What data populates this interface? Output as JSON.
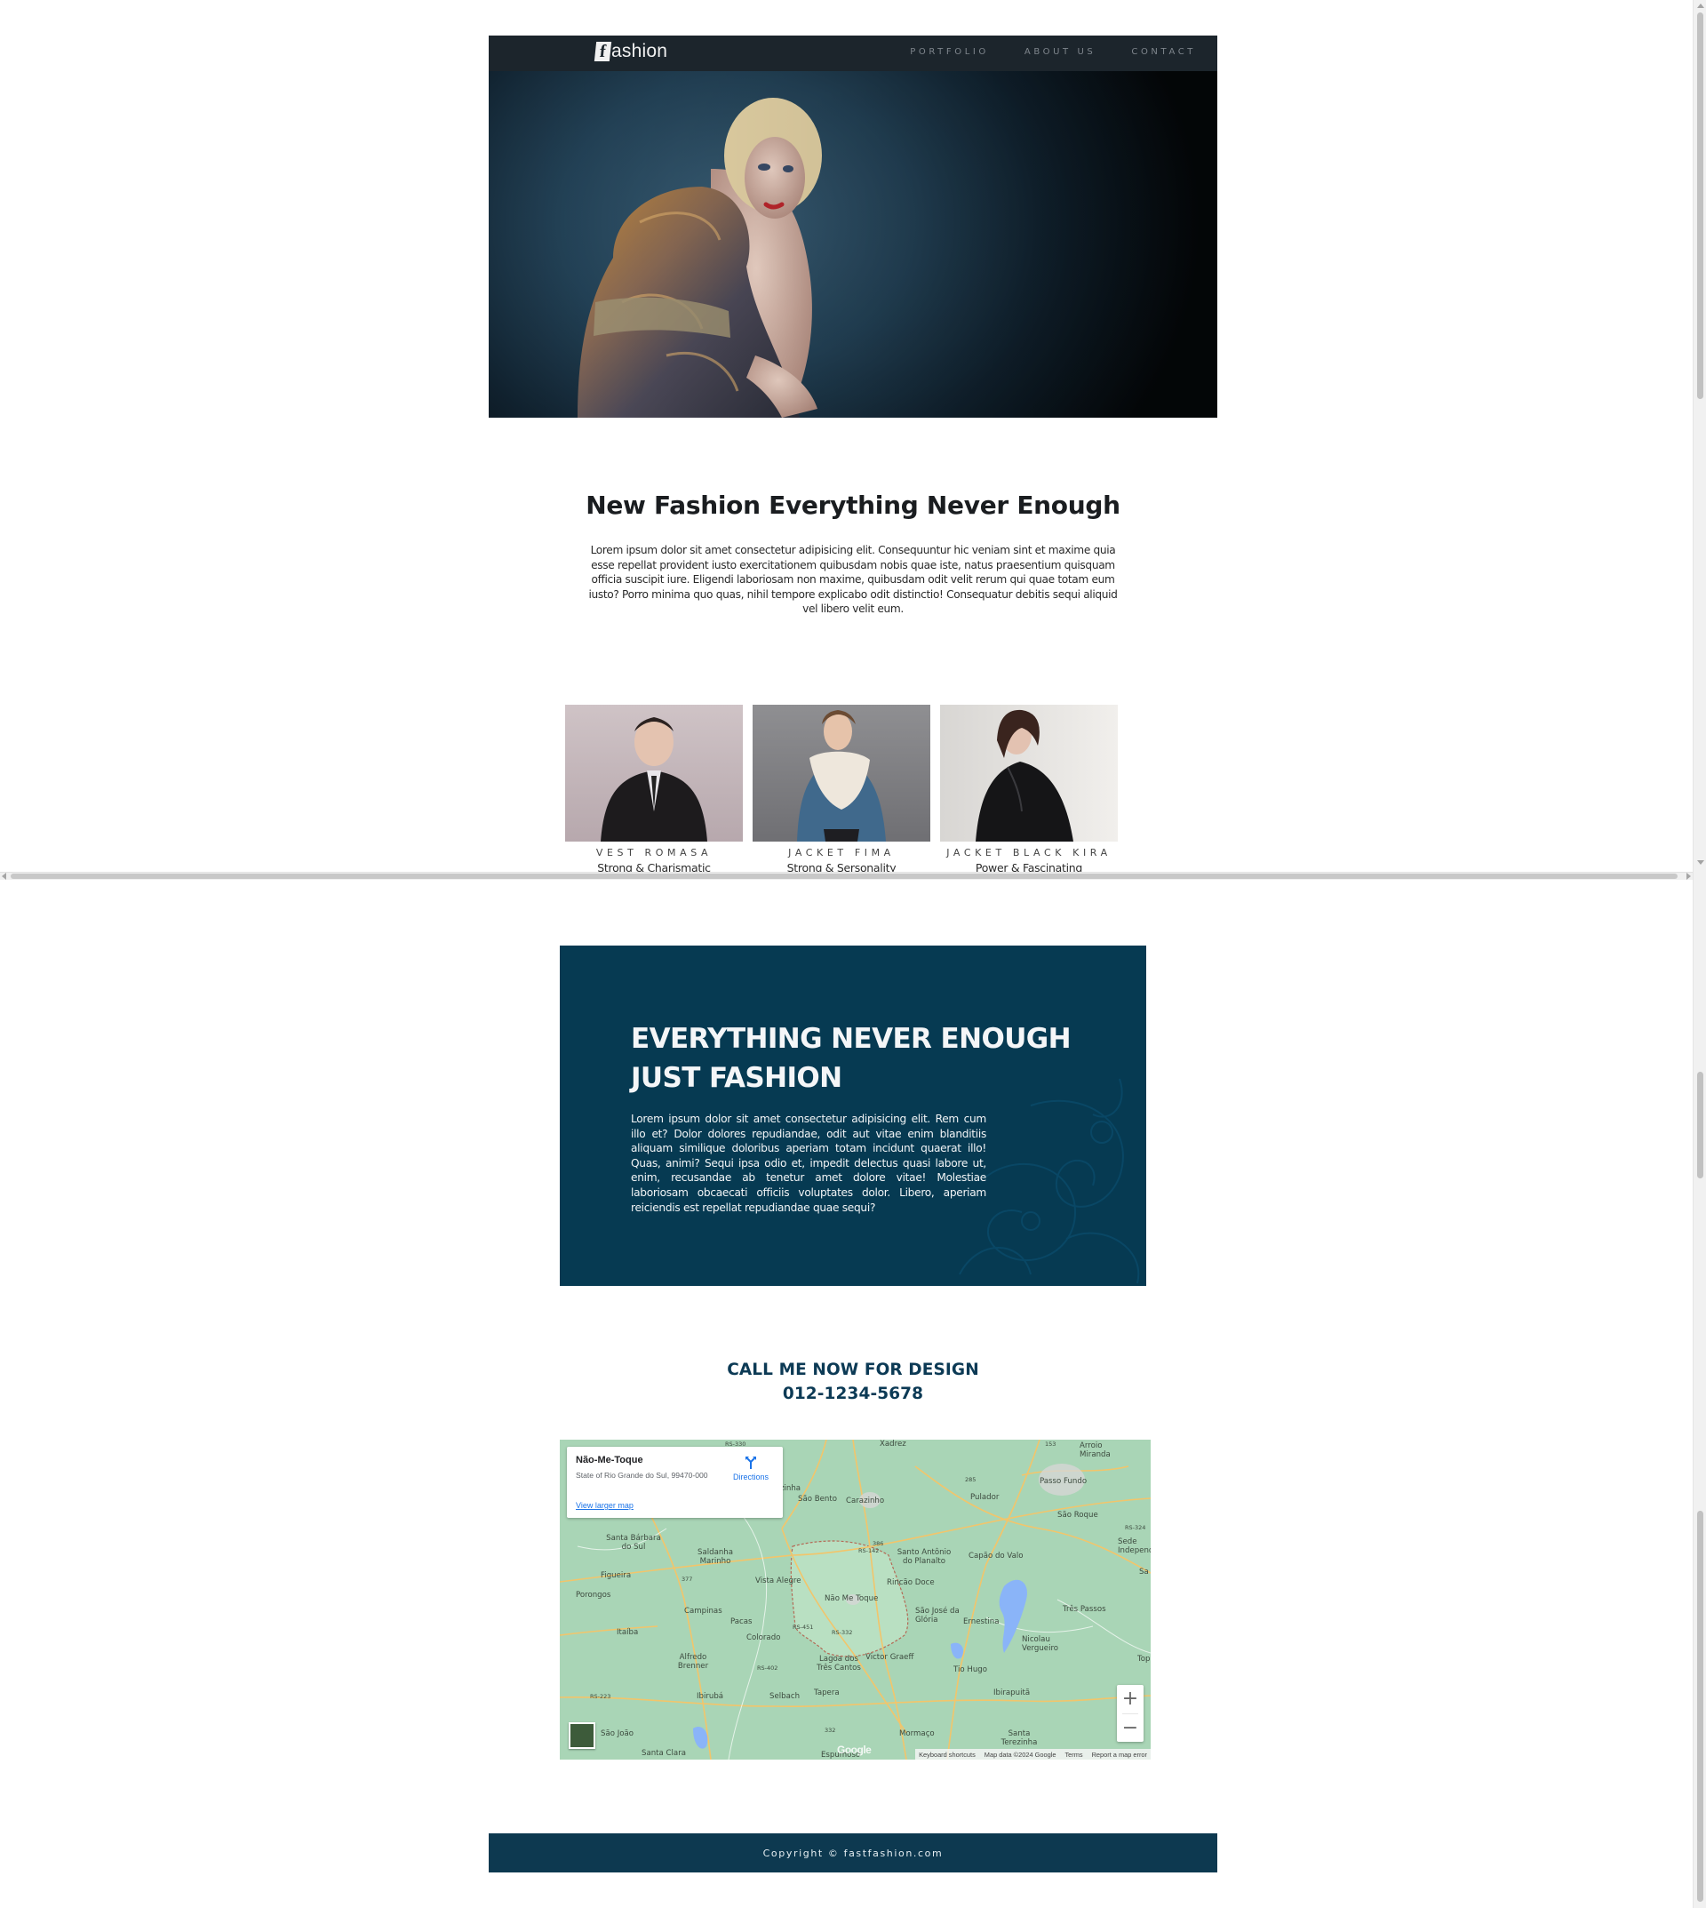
{
  "header": {
    "logo_mark": "f",
    "logo_text": "ashion",
    "nav": [
      {
        "label": "PORTFOLIO"
      },
      {
        "label": "ABOUT US"
      },
      {
        "label": "CONTACT"
      }
    ]
  },
  "intro": {
    "title": "New Fashion Everything Never Enough",
    "text": "Lorem ipsum dolor sit amet consectetur adipisicing elit. Consequuntur hic veniam sint et maxime quia esse repellat provident iusto exercitationem quibusdam nobis quae iste, natus praesentium quisquam officia suscipit iure. Eligendi laboriosam non maxime, quibusdam odit velit rerum qui quae totam eum iusto? Porro minima quo quas, nihil tempore explicabo odit distinctio! Consequatur debitis sequi aliquid vel libero velit eum."
  },
  "products": [
    {
      "name": "VEST ROMASA",
      "tag": "Strong & Charismatic"
    },
    {
      "name": "JACKET FIMA",
      "tag": "Strong & Sersonality"
    },
    {
      "name": "JACKET BLACK KIRA",
      "tag": "Power & Fascinating"
    }
  ],
  "promo": {
    "title_line1": "EVERYTHING NEVER ENOUGH",
    "title_line2": "JUST FASHION",
    "text": "Lorem ipsum dolor sit amet consectetur adipisicing elit. Rem cum illo et? Dolor dolores repudiandae, odit aut vitae enim blanditiis aliquam similique doloribus aperiam totam incidunt quaerat illo! Quas, animi? Sequi ipsa odio et, impedit delectus quasi labore ut, enim, recusandae ab tenetur amet dolore vitae! Molestiae laboriosam obcaecati officiis voluptates dolor. Libero, aperiam reiciendis est repellat repudiandae quae sequi?",
    "bg_color": "#063a52"
  },
  "call": {
    "line1": "CALL ME NOW FOR DESIGN",
    "line2": "012-1234-5678"
  },
  "map": {
    "place_name": "Não-Me-Toque",
    "address": "State of Rio Grande do Sul, 99470-000",
    "directions_label": "Directions",
    "larger_map_label": "View larger map",
    "zoom_in": "+",
    "zoom_out": "−",
    "google_label": "Google",
    "attribution": {
      "shortcuts": "Keyboard shortcuts",
      "data": "Map data ©2024 Google",
      "terms": "Terms",
      "report": "Report a map error"
    },
    "places": [
      {
        "name": "Xadrez"
      },
      {
        "name": "Arroio Miranda"
      },
      {
        "name": "Passo Fundo"
      },
      {
        "name": "São Bento"
      },
      {
        "name": "Carazinho"
      },
      {
        "name": "Pulador"
      },
      {
        "name": "São Roque"
      },
      {
        "name": "Santa Bárbara do Sul"
      },
      {
        "name": "Saldanha Marinho"
      },
      {
        "name": "Santo Antônio do Planalto"
      },
      {
        "name": "Capão do Valo"
      },
      {
        "name": "Sede Independente"
      },
      {
        "name": "Figueira"
      },
      {
        "name": "Vista Alegre"
      },
      {
        "name": "Rincão Doce"
      },
      {
        "name": "Porongos"
      },
      {
        "name": "Não Me Toque"
      },
      {
        "name": "Campinas"
      },
      {
        "name": "Pacas"
      },
      {
        "name": "São José da Glória"
      },
      {
        "name": "Ernestina"
      },
      {
        "name": "Três Passos"
      },
      {
        "name": "Itaíba"
      },
      {
        "name": "Colorado"
      },
      {
        "name": "Nicolau Vergueiro"
      },
      {
        "name": "Alfredo Brenner"
      },
      {
        "name": "Lagoa dos Três Cantos"
      },
      {
        "name": "Victor Graeff"
      },
      {
        "name": "Tio Hugo"
      },
      {
        "name": "Ibirubá"
      },
      {
        "name": "Selbach"
      },
      {
        "name": "Tapera"
      },
      {
        "name": "Ibirapuitã"
      },
      {
        "name": "São João"
      },
      {
        "name": "Mormaço"
      },
      {
        "name": "Santa Terezinha"
      },
      {
        "name": "Santa Clara"
      },
      {
        "name": "Espumoso"
      },
      {
        "name": "Top"
      },
      {
        "name": "Sa"
      },
      {
        "name": "zinha"
      }
    ],
    "route_labels": [
      {
        "label": "153"
      },
      {
        "label": "285"
      },
      {
        "label": "RS-324"
      },
      {
        "label": "377"
      },
      {
        "label": "386"
      },
      {
        "label": "RS-142"
      },
      {
        "label": "RS-451"
      },
      {
        "label": "RS-332"
      },
      {
        "label": "RS-402"
      },
      {
        "label": "RS-223"
      },
      {
        "label": "RS-330"
      },
      {
        "label": "332"
      }
    ]
  },
  "footer": {
    "text": "Copyright © fastfashion.com",
    "bg_color": "#0d3950"
  }
}
